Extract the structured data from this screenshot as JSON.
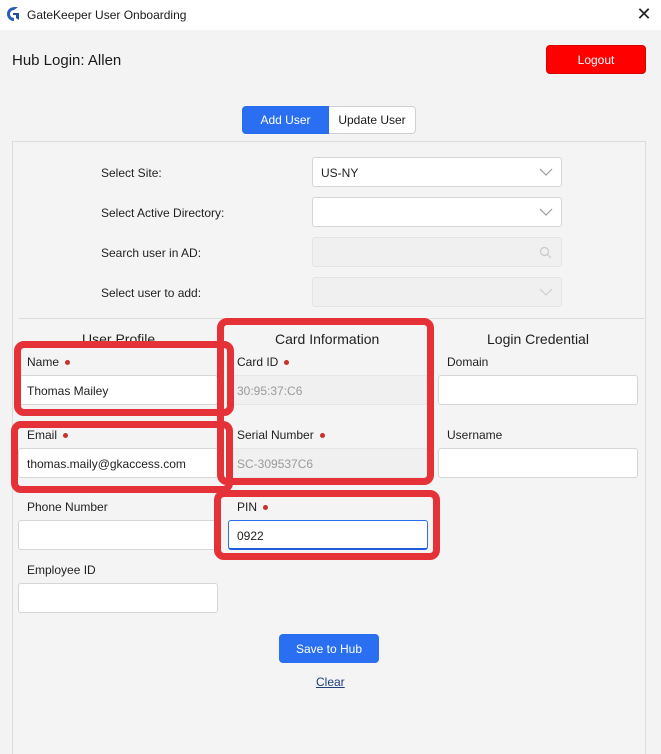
{
  "window": {
    "title": "GateKeeper User Onboarding",
    "app_icon": "gatekeeper-logo-icon",
    "close_icon": "close-icon",
    "close_glyph": "✕"
  },
  "header": {
    "hub_login": "Hub Login: Allen",
    "logout_label": "Logout",
    "logout_color": "#ff0000"
  },
  "tabs": {
    "add_user": "Add User",
    "update_user": "Update User",
    "active": "Add User",
    "accent": "#2a6ef2"
  },
  "selection": {
    "site_label": "Select Site:",
    "site_value": "US-NY",
    "ad_label": "Select Active Directory:",
    "ad_value": "",
    "search_label": "Search user in AD:",
    "search_value": "",
    "user_label": "Select user to add:",
    "user_value": ""
  },
  "user_profile": {
    "title": "User Profile",
    "name_label": "Name",
    "name_value": "Thomas Mailey",
    "email_label": "Email",
    "email_value": "thomas.maily@gkaccess.com",
    "phone_label": "Phone Number",
    "phone_value": "",
    "employee_label": "Employee ID",
    "employee_value": ""
  },
  "card_information": {
    "title": "Card Information",
    "card_id_label": "Card ID",
    "card_id_value": "30:95:37:C6",
    "serial_label": "Serial Number",
    "serial_value": "SC-309537C6",
    "pin_label": "PIN",
    "pin_value": "0922"
  },
  "login_credential": {
    "title": "Login Credential",
    "domain_label": "Domain",
    "domain_value": "",
    "username_label": "Username",
    "username_value": ""
  },
  "actions": {
    "save_label": "Save to Hub",
    "clear_label": "Clear"
  },
  "colors": {
    "required_dot": "#c8322d",
    "highlight": "#e53238"
  }
}
